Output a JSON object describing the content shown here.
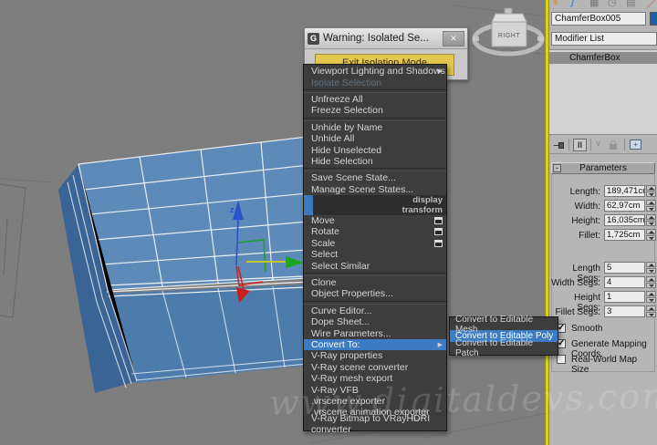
{
  "icons": {
    "close": "✕",
    "submenu_arrow": "▶",
    "check": "✓",
    "collapse": "-",
    "show_end_result": "II",
    "make_unique": "∨",
    "configure_modifier": "+",
    "create_tab": "✳",
    "modify_tab": "ʃ",
    "hierarchy_tab": "▦",
    "motion_tab": "◷",
    "display_tab": "▤",
    "utilities_tab": "／"
  },
  "colors": {
    "highlight_blue": "#3c7cc4",
    "menu_background": "#3d3d3d",
    "warning_button_yellow": "#e2c64e",
    "object_color_swatch": "#2060a8",
    "viewport_gray": "#7e7e7e",
    "box_blue_top": "#5d8ab8",
    "active_viewport_border": "#ddd600"
  },
  "viewport": {
    "watermark": "www.digitaldevs.com",
    "viewcube_face": "RIGHT",
    "gizmo_z_label": "z"
  },
  "dialog": {
    "title": "Warning: Isolated Se...",
    "button_label": "Exit Isolation Mode"
  },
  "context_menu": {
    "headers": [
      "display",
      "transform"
    ],
    "items": [
      "Viewport Lighting and Shadows",
      "Isolate Selection",
      "Unfreeze All",
      "Freeze Selection",
      "Unhide by Name",
      "Unhide All",
      "Hide Unselected",
      "Hide Selection",
      "Save Scene State...",
      "Manage Scene States...",
      "Move",
      "Rotate",
      "Scale",
      "Select",
      "Select Similar",
      "Clone",
      "Object Properties...",
      "Curve Editor...",
      "Dope Sheet...",
      "Wire Parameters...",
      "Convert To:",
      "V-Ray properties",
      "V-Ray scene converter",
      "V-Ray mesh export",
      "V-Ray VFB",
      ".vrscene exporter",
      ".vrscene animation exporter",
      "V-Ray Bitmap to VRayHDRI converter"
    ]
  },
  "submenu": {
    "items": [
      "Convert to Editable Mesh",
      "Convert to Editable Poly",
      "Convert to Editable Patch"
    ],
    "highlighted_index": 1
  },
  "panel": {
    "object_name": "ChamferBox005",
    "modifier_list_label": "Modifier List",
    "stack_items": [
      "ChamferBox"
    ],
    "rollout_title": "Parameters",
    "params": [
      {
        "label": "Length:",
        "value": "189,471cm"
      },
      {
        "label": "Width:",
        "value": "62,97cm"
      },
      {
        "label": "Height:",
        "value": "16,035cm"
      },
      {
        "label": "Fillet:",
        "value": "1,725cm"
      },
      {
        "label": "Length Segs:",
        "value": "5"
      },
      {
        "label": "Width Segs:",
        "value": "4"
      },
      {
        "label": "Height Segs:",
        "value": "1"
      },
      {
        "label": "Fillet Segs:",
        "value": "3"
      }
    ],
    "checkboxes": [
      {
        "label": "Smooth",
        "checked": true
      },
      {
        "label": "Generate Mapping Coords.",
        "checked": true
      },
      {
        "label": "Real-World Map Size",
        "checked": false
      }
    ]
  }
}
